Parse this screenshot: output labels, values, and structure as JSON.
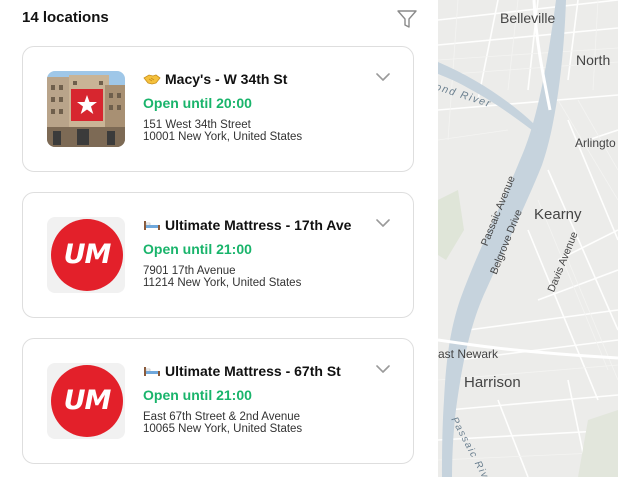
{
  "list": {
    "count_label": "14 locations",
    "filter_icon": "filter-icon"
  },
  "stores": [
    {
      "icon": "handshake-emoji",
      "name": "Macy's - W 34th St",
      "status": "Open until 20:00",
      "address_line1": "151 West 34th Street",
      "address_line2": "10001 New York, United States",
      "thumbnail": "store-photo"
    },
    {
      "icon": "bed-emoji",
      "name": "Ultimate Mattress - 17th Ave",
      "status": "Open until 21:00",
      "address_line1": "7901 17th Avenue",
      "address_line2": "11214 New York, United States",
      "thumbnail": "um-logo",
      "logo_text": "UM"
    },
    {
      "icon": "bed-emoji",
      "name": "Ultimate Mattress - 67th St",
      "status": "Open until 21:00",
      "address_line1": "East 67th Street & 2nd Avenue",
      "address_line2": "10065 New York, United States",
      "thumbnail": "um-logo",
      "logo_text": "UM"
    }
  ],
  "colors": {
    "open_status": "#19b46b",
    "logo_red": "#e3202a",
    "card_border": "#dedede"
  },
  "map": {
    "labels": {
      "belleville": "Belleville",
      "north": "North",
      "second_river": "Second River",
      "arlington": "Arlingto",
      "passaic_ave": "Passaic Avenue",
      "kearny": "Kearny",
      "belgrove": "Belgrove Drive",
      "davis": "Davis Avenue",
      "east_newark": "ast Newark",
      "harrison": "Harrison",
      "passaic_river": "Passaic River"
    }
  }
}
